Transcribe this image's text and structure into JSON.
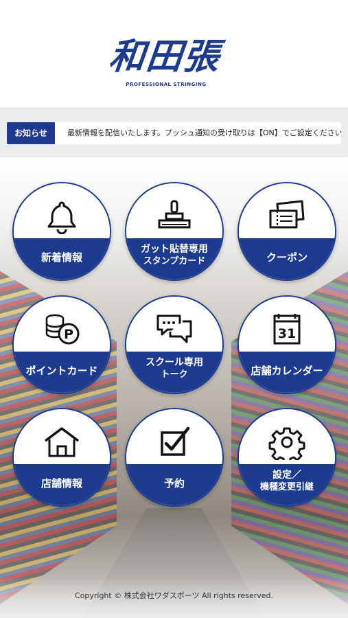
{
  "logo": {
    "main": "和田張",
    "sub": "PROFESSIONAL STRINGING"
  },
  "news": {
    "label": "お知らせ",
    "text": "最新情報を配信いたします。プッシュ通知の受け取りは【ON】でご設定ください。"
  },
  "menu": [
    {
      "label": "新着情報",
      "icon": "bell-icon"
    },
    {
      "label_line1": "ガット貼替専用",
      "label_line2": "スタンプカード",
      "icon": "stamp-icon"
    },
    {
      "label": "クーポン",
      "icon": "coupon-icon"
    },
    {
      "label": "ポイントカード",
      "icon": "coins-points-icon",
      "badge": "P"
    },
    {
      "label_line1": "スクール専用",
      "label_line2": "トーク",
      "icon": "chat-bubbles-icon"
    },
    {
      "label": "店舗カレンダー",
      "icon": "calendar-icon",
      "day": "31"
    },
    {
      "label": "店舗情報",
      "icon": "house-icon"
    },
    {
      "label": "予約",
      "icon": "checkbox-icon"
    },
    {
      "label_line1": "設定／",
      "label_line2": "機種変更引継",
      "icon": "gear-icon"
    }
  ],
  "footer": {
    "copyright": "Copyright © 株式会社ワダスポーツ All rights reserved."
  },
  "colors": {
    "brand_navy": "#1e3a8e",
    "news_band": "#ececec"
  }
}
